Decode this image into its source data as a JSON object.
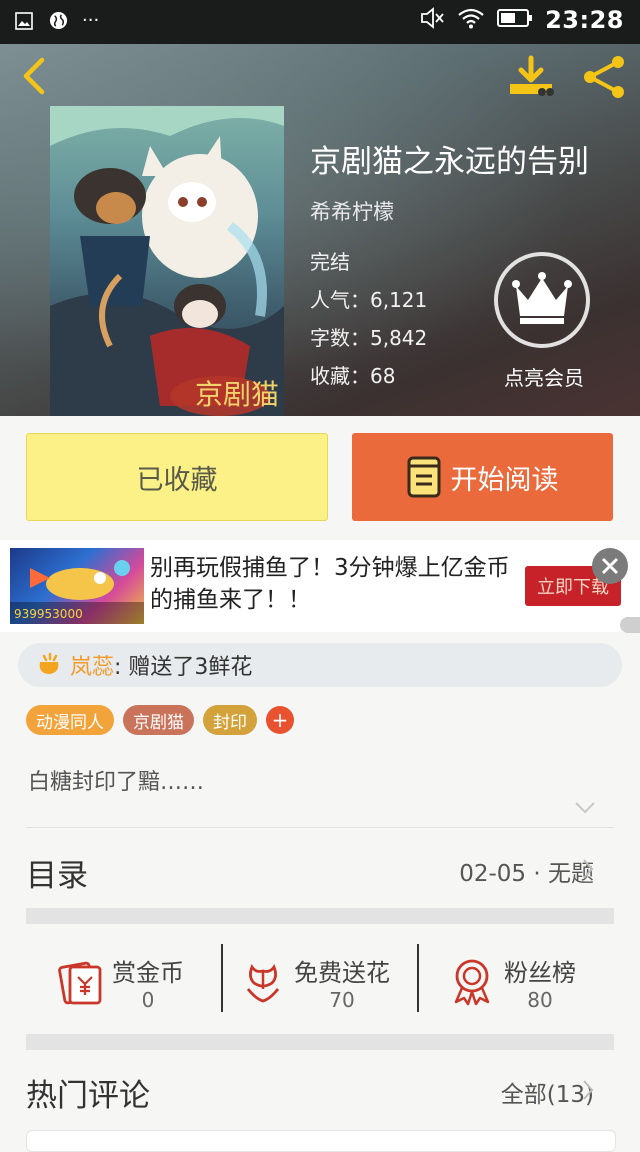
{
  "status_bar": {
    "time": "23:28",
    "dots": "···"
  },
  "book": {
    "title": "京剧猫之永远的告别",
    "author": "希希柠檬",
    "status": "完结",
    "popularity": "人气：6,121",
    "word_count": "字数：5,842",
    "favorites": "收藏：68",
    "cover_logo_text": "京剧猫"
  },
  "vip": {
    "label": "点亮会员"
  },
  "actions": {
    "collected_label": "已收藏",
    "read_label": "开始阅读"
  },
  "ad": {
    "text": "别再玩假捕鱼了！3分钟爆上亿金币的捕鱼来了！！",
    "button": "立即下载",
    "image_text": "939953000"
  },
  "gift": {
    "user": "岚蕊",
    "message": " : 赠送了3鲜花"
  },
  "tags": [
    {
      "label": "动漫同人",
      "color": "#f2a33a"
    },
    {
      "label": "京剧猫",
      "color": "#c9735a"
    },
    {
      "label": "封印",
      "color": "#d4a23a"
    }
  ],
  "tag_add": "+",
  "description": "白糖封印了黯……",
  "toc": {
    "title": "目录",
    "latest": "02-05 · 无题"
  },
  "stats": [
    {
      "label": "赏金币",
      "value": "0"
    },
    {
      "label": "免费送花",
      "value": "70"
    },
    {
      "label": "粉丝榜",
      "value": "80"
    }
  ],
  "hot_comments": {
    "title": "热门评论",
    "all": "全部(13)"
  }
}
